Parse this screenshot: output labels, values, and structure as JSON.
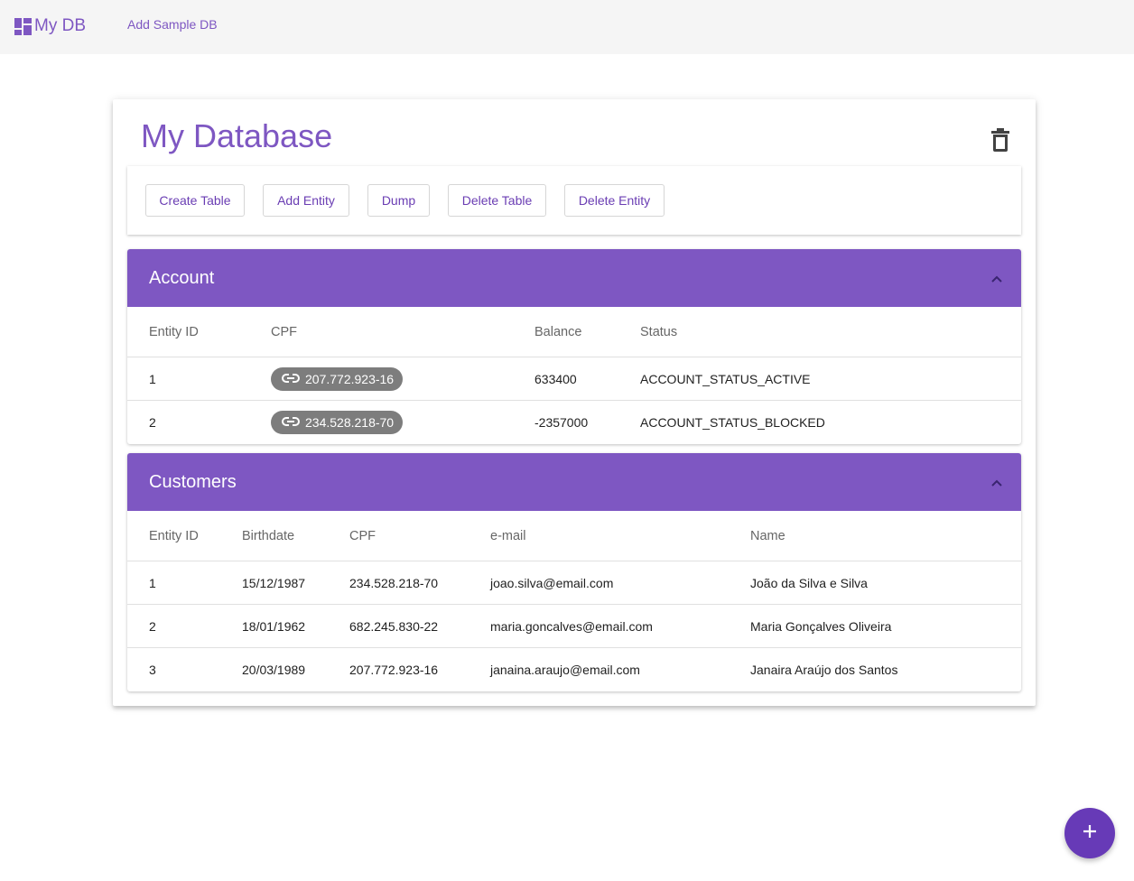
{
  "app": {
    "title": "My DB",
    "nav_link": "Add Sample DB"
  },
  "database": {
    "title": "My Database",
    "toolbar": {
      "create_table": "Create Table",
      "add_entity": "Add Entity",
      "dump": "Dump",
      "delete_table": "Delete Table",
      "delete_entity": "Delete Entity"
    }
  },
  "tables": {
    "account": {
      "name": "Account",
      "columns": [
        "Entity ID",
        "CPF",
        "Balance",
        "Status"
      ],
      "rows": [
        {
          "id": "1",
          "cpf": "207.772.923-16",
          "balance": "633400",
          "status": "ACCOUNT_STATUS_ACTIVE"
        },
        {
          "id": "2",
          "cpf": "234.528.218-70",
          "balance": "-2357000",
          "status": "ACCOUNT_STATUS_BLOCKED"
        }
      ]
    },
    "customers": {
      "name": "Customers",
      "columns": [
        "Entity ID",
        "Birthdate",
        "CPF",
        "e-mail",
        "Name"
      ],
      "rows": [
        {
          "id": "1",
          "birthdate": "15/12/1987",
          "cpf": "234.528.218-70",
          "email": "joao.silva@email.com",
          "name": "João da Silva e Silva"
        },
        {
          "id": "2",
          "birthdate": "18/01/1962",
          "cpf": "682.245.830-22",
          "email": "maria.goncalves@email.com",
          "name": "Maria Gonçalves Oliveira"
        },
        {
          "id": "3",
          "birthdate": "20/03/1989",
          "cpf": "207.772.923-16",
          "email": "janaina.araujo@email.com",
          "name": "Janaira Araújo dos Santos"
        }
      ]
    }
  },
  "icons": {
    "logo": "dashboard-icon",
    "delete": "trash-icon",
    "collapse": "chevron-up-icon",
    "link": "link-icon",
    "add": "plus-icon"
  },
  "colors": {
    "accent": "#7e57c2",
    "fab": "#673ab7",
    "chip": "#7d7d7d"
  }
}
